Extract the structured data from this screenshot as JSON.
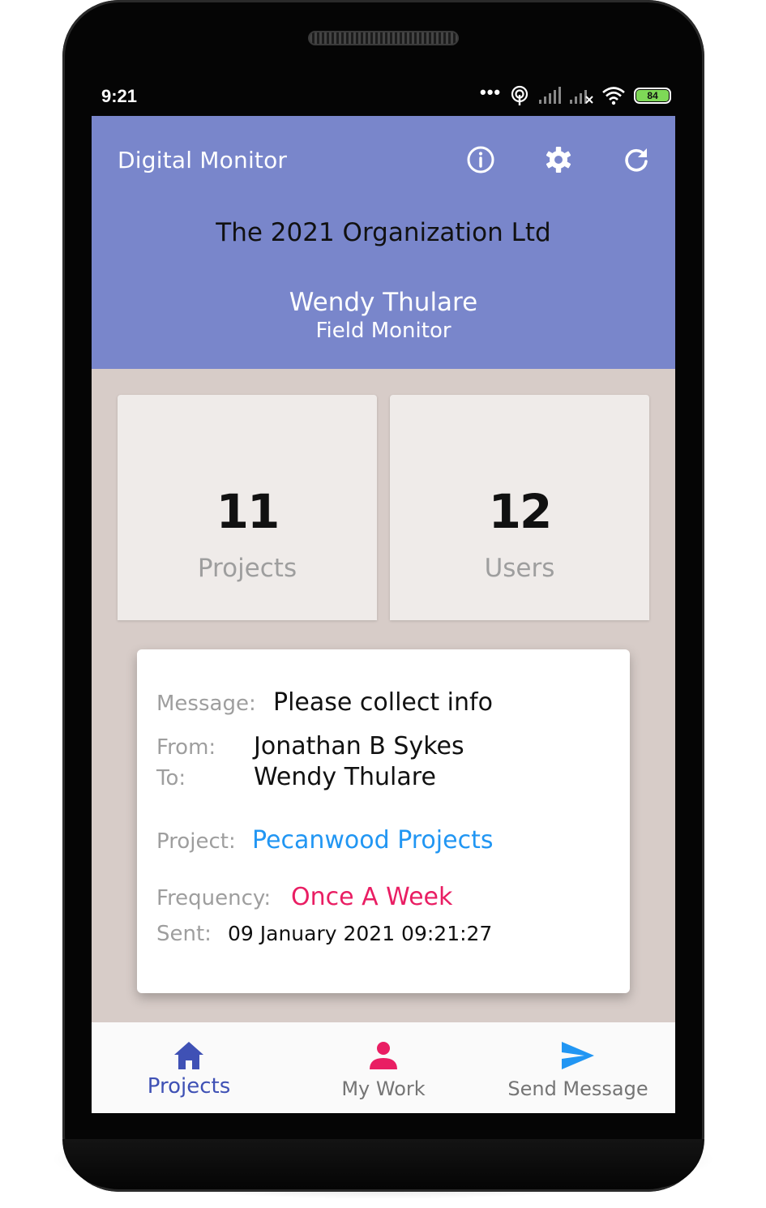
{
  "status_bar": {
    "time": "9:21",
    "dots": "•••",
    "battery": "84"
  },
  "appbar": {
    "title": "Digital Monitor",
    "icons": [
      "info-icon",
      "settings-gear-icon",
      "refresh-icon"
    ],
    "organization": "The 2021 Organization Ltd",
    "user_name": "Wendy Thulare",
    "user_role": "Field Monitor",
    "color": "#7986cb"
  },
  "stats": [
    {
      "value": "11",
      "label": "Projects"
    },
    {
      "value": "12",
      "label": "Users"
    }
  ],
  "message": {
    "message_label": "Message:",
    "message_value": "Please collect info",
    "from_label": "From:",
    "from_value": "Jonathan B Sykes",
    "to_label": "To:",
    "to_value": "Wendy Thulare",
    "project_label": "Project:",
    "project_value": "Pecanwood Projects",
    "project_color": "#2196f3",
    "frequency_label": "Frequency:",
    "frequency_value": "Once A Week",
    "frequency_color": "#e91e63",
    "sent_label": "Sent:",
    "sent_value": "09 January 2021 09:21:27"
  },
  "bottom_nav": {
    "items": [
      {
        "label": "Projects",
        "icon": "home-icon",
        "active": true
      },
      {
        "label": "My Work",
        "icon": "person-icon",
        "active": false
      },
      {
        "label": "Send Message",
        "icon": "send-icon",
        "active": false
      }
    ],
    "active_color": "#3f51b5",
    "inactive_color": "#757575"
  }
}
